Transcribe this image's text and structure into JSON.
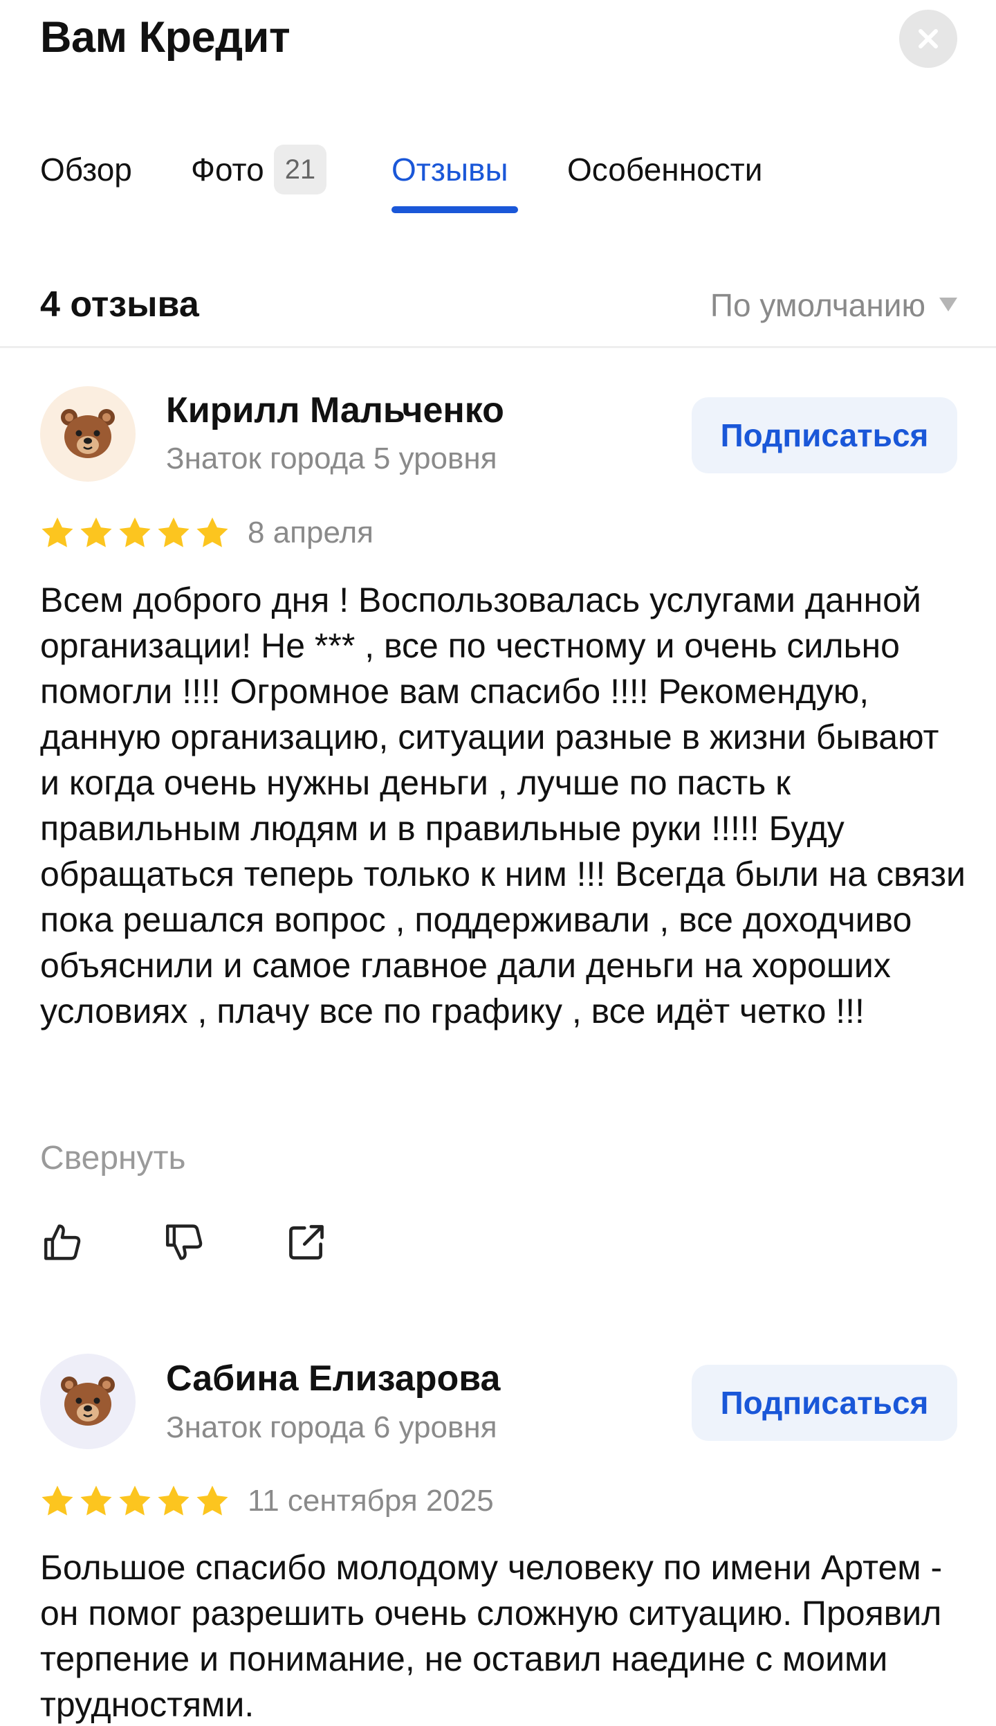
{
  "header": {
    "title": "Вам Кредит"
  },
  "tabs": [
    {
      "label": "Обзор"
    },
    {
      "label": "Фото",
      "badge": "21"
    },
    {
      "label": "Отзывы",
      "active": true
    },
    {
      "label": "Особенности"
    }
  ],
  "reviews_summary": {
    "count_label": "4 отзыва",
    "sort_label": "По умолчанию"
  },
  "colors": {
    "accent": "#1a57d8",
    "star": "#fcc51f",
    "muted": "#8a8a8a"
  },
  "reviews": [
    {
      "author": "Кирилл Мальченко",
      "level": "Знаток города 5 уровня",
      "subscribe_label": "Подписаться",
      "rating": 5,
      "date": "8 апреля",
      "avatar_icon": "bear-icon",
      "text": "Всем доброго дня ! Воспользовалась услугами данной организации! Не *** , все по честному и очень сильно помогли !!!! Огромное вам спасибо !!!! Рекомендую, данную организацию, ситуации разные в жизни бывают и когда очень нужны деньги , лучше по пасть к правильным людям и в правильные руки !!!!! Буду обращаться теперь только к ним !!! Всегда были на связи  пока решался вопрос , поддерживали , все доходчиво объяснили и самое главное дали деньги на хороших условиях , плачу все по графику , все идёт четко !!!",
      "collapse_label": "Свернуть"
    },
    {
      "author": "Сабина Елизарова",
      "level": "Знаток города 6 уровня",
      "subscribe_label": "Подписаться",
      "rating": 5,
      "date": "11 сентября 2025",
      "avatar_icon": "bear-icon",
      "text": "Большое спасибо молодому человеку по имени Артем - он помог разрешить  очень сложную ситуацию.  Проявил терпение и понимание, не оставил наедине с моими трудностями."
    }
  ]
}
